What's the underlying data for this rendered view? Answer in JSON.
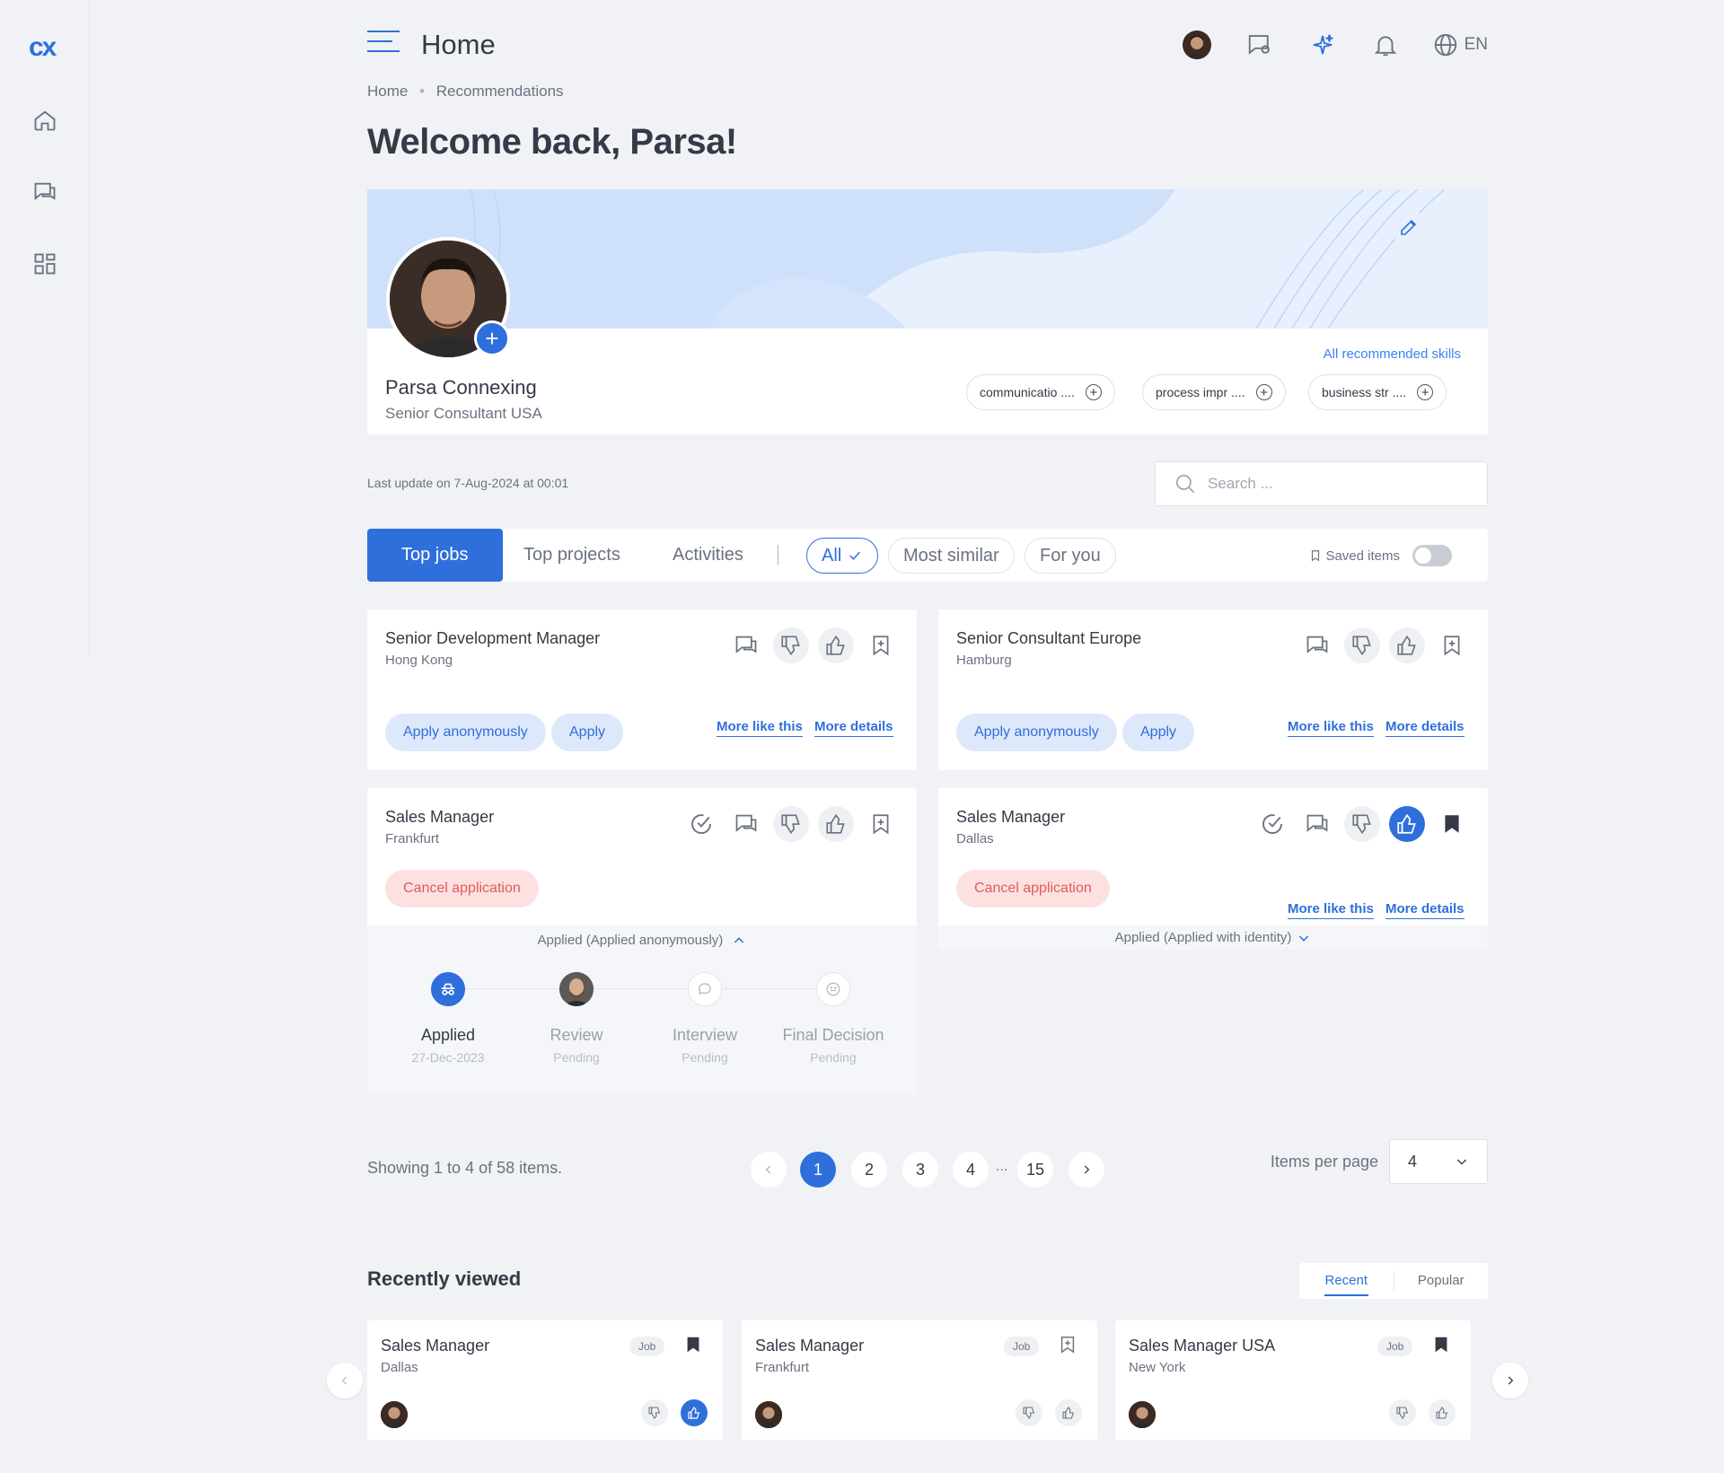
{
  "app": {
    "logo": "cx",
    "page_title": "Home",
    "lang": "EN"
  },
  "breadcrumb": [
    "Home",
    "Recommendations"
  ],
  "welcome": "Welcome back, Parsa!",
  "profile": {
    "name": "Parsa Connexing",
    "title": "Senior Consultant USA",
    "all_skills_label": "All recommended skills",
    "skills": [
      "communicatio ....",
      "process impr ....",
      "business str ...."
    ]
  },
  "last_update": "Last update on 7-Aug-2024 at 00:01",
  "search": {
    "placeholder": "Search ..."
  },
  "tabs": {
    "top_jobs": "Top jobs",
    "top_projects": "Top projects",
    "activities": "Activities"
  },
  "filters": {
    "all": "All",
    "most_similar": "Most similar",
    "for_you": "For you"
  },
  "saved_items": "Saved items",
  "cards": [
    {
      "title": "Senior Development Manager",
      "location": "Hong Kong",
      "apply_anon": "Apply anonymously",
      "apply": "Apply",
      "more_like": "More like this",
      "more_details": "More details"
    },
    {
      "title": "Senior Consultant Europe",
      "location": "Hamburg",
      "apply_anon": "Apply anonymously",
      "apply": "Apply",
      "more_like": "More like this",
      "more_details": "More details"
    },
    {
      "title": "Sales Manager",
      "location": "Frankfurt",
      "cancel": "Cancel application",
      "status": "Applied (Applied anonymously)",
      "steps": [
        {
          "label": "Applied",
          "sub": "27-Dec-2023"
        },
        {
          "label": "Review",
          "sub": "Pending"
        },
        {
          "label": "Interview",
          "sub": "Pending"
        },
        {
          "label": "Final Decision",
          "sub": "Pending"
        }
      ]
    },
    {
      "title": "Sales Manager",
      "location": "Dallas",
      "cancel": "Cancel application",
      "more_like": "More like this",
      "more_details": "More details",
      "status": "Applied (Applied with identity)"
    }
  ],
  "pagination": {
    "info": "Showing 1 to 4 of 58 items.",
    "pages": [
      "1",
      "2",
      "3",
      "4",
      "15"
    ],
    "ellipsis": "...",
    "items_per_page_label": "Items per page",
    "items_per_page": "4"
  },
  "recently_viewed": {
    "title": "Recently viewed",
    "tabs": [
      "Recent",
      "Popular"
    ],
    "items": [
      {
        "title": "Sales Manager",
        "location": "Dallas",
        "badge": "Job"
      },
      {
        "title": "Sales Manager",
        "location": "Frankfurt",
        "badge": "Job"
      },
      {
        "title": "Sales Manager USA",
        "location": "New York",
        "badge": "Job"
      }
    ]
  },
  "colors": {
    "accent": "#2f6fdc",
    "danger": "#e05a5a",
    "banner": "#dce9fc"
  }
}
